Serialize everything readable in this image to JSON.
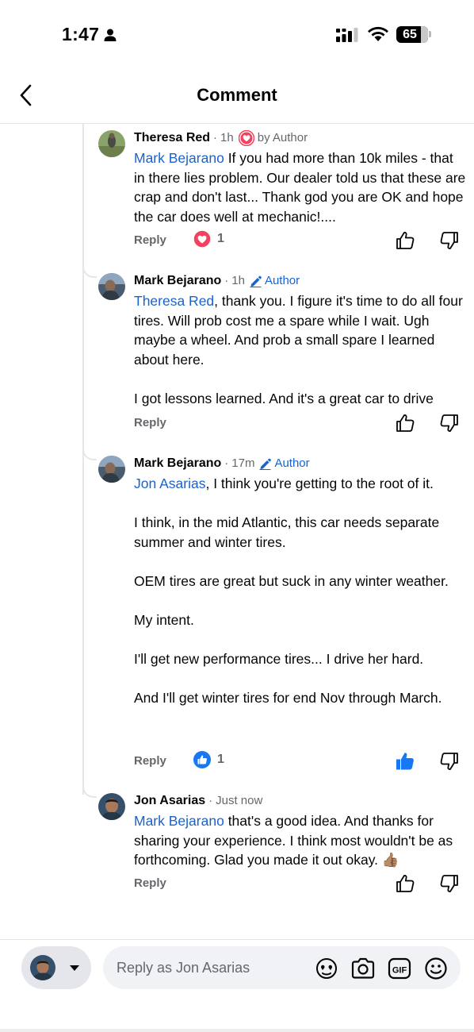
{
  "status_bar": {
    "time": "1:47",
    "battery": "65"
  },
  "header": {
    "title": "Comment"
  },
  "comments": [
    {
      "author": "Theresa Red",
      "time_ago": "1h",
      "badge": "by Author",
      "mention": "Mark Bejarano",
      "paragraphs": [
        "If you had more than 10k miles - that in there lies problem.  Our dealer told us that these are crap and don't last... Thank god you are OK and hope the car does well at mechanic!...."
      ],
      "reply_label": "Reply",
      "reaction": "heart",
      "reaction_count": "1",
      "liked": false
    },
    {
      "author": "Mark Bejarano",
      "time_ago": "1h",
      "badge": "Author",
      "mention": "Theresa Red",
      "paragraphs": [
        ", thank you. I figure it's time to do all four tires. Will prob cost me a spare while I wait. Ugh maybe a wheel. And prob a small spare I learned about here.",
        "I got lessons learned. And it's a great car to drive"
      ],
      "reply_label": "Reply",
      "reaction": "",
      "reaction_count": "",
      "liked": false
    },
    {
      "author": "Mark Bejarano",
      "time_ago": "17m",
      "badge": "Author",
      "mention": "Jon Asarias",
      "paragraphs": [
        ", I think you're getting to the root of it.",
        "I think, in the mid Atlantic, this car needs separate summer and winter tires.",
        "OEM tires are great but suck in any winter weather.",
        "My intent.",
        "I'll get new performance tires... I drive her hard.",
        "And I'll get winter tires for end Nov through March."
      ],
      "reply_label": "Reply",
      "reaction": "like",
      "reaction_count": "1",
      "liked": true
    },
    {
      "author": "Jon Asarias",
      "time_ago": "Just now",
      "badge": "",
      "mention": "Mark Bejarano",
      "paragraphs": [
        "that's a good idea. And thanks for sharing your experience. I think most wouldn't be as forthcoming. Glad you made it out okay. 👍🏽"
      ],
      "reply_label": "Reply",
      "reaction": "",
      "reaction_count": "",
      "liked": false
    }
  ],
  "composer": {
    "placeholder": "Reply as Jon Asarias",
    "icons": [
      "avatar-sticker-icon",
      "camera-icon",
      "gif-icon",
      "emoji-icon"
    ]
  },
  "colors": {
    "link": "#1763cf",
    "muted": "#65676b",
    "heart": "#f3425f",
    "like": "#1877f2"
  }
}
